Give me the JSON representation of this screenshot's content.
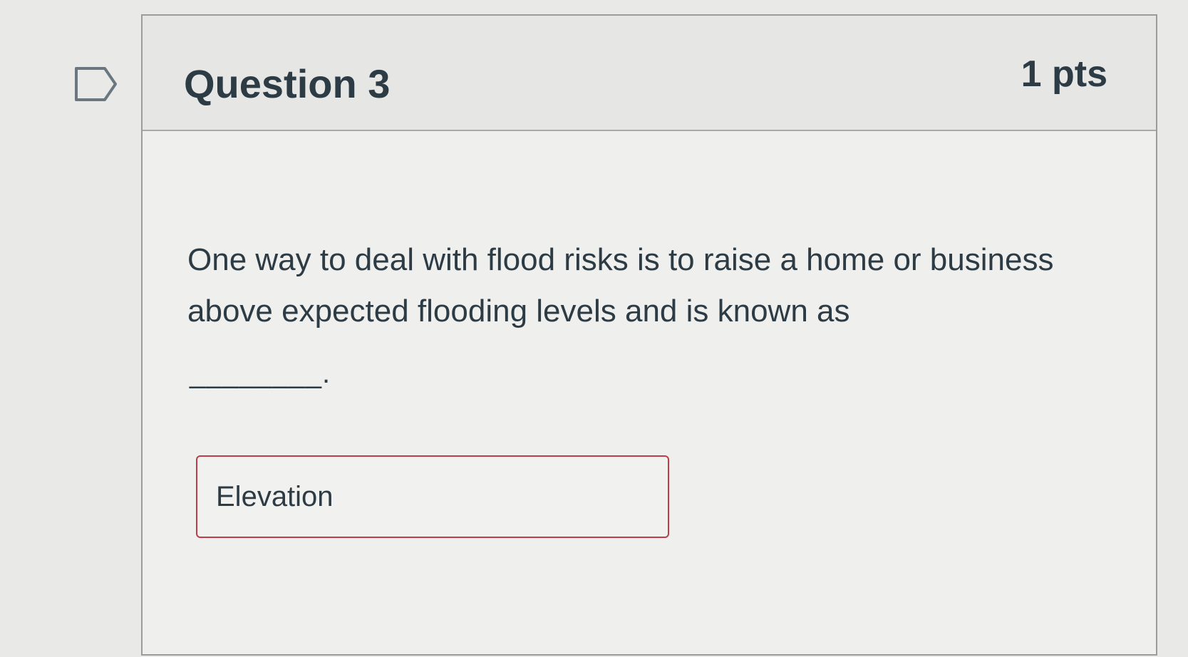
{
  "question": {
    "title": "Question 3",
    "points": "1 pts",
    "text": "One way to deal with flood risks is to raise a home or business above expected flooding levels and is known as",
    "blank": "________."
  },
  "answer": {
    "value": "Elevation"
  },
  "icons": {
    "flag": "flag-question-icon"
  },
  "colors": {
    "input_border": "#c03c4c",
    "text": "#2d3b45"
  }
}
